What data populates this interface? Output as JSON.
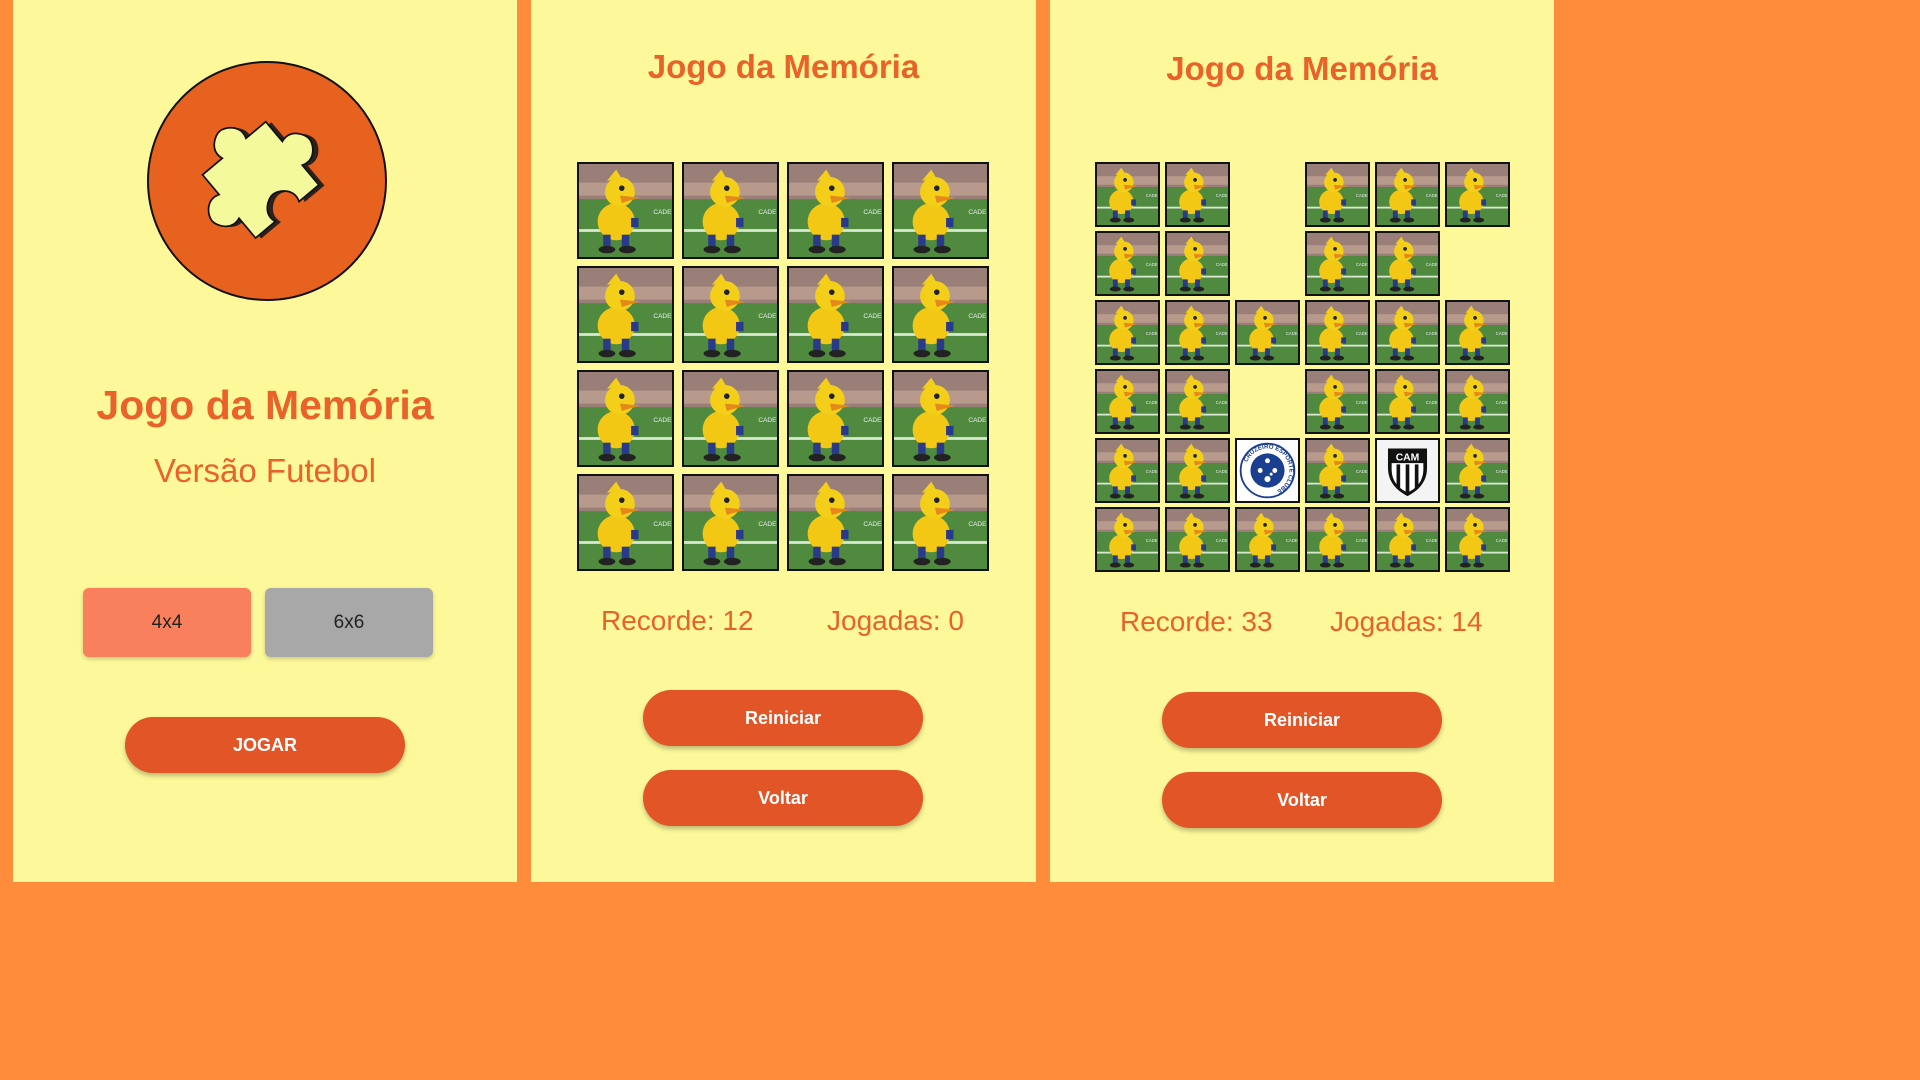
{
  "colors": {
    "accent": "#E8622A",
    "button": "#E15527",
    "background": "#FDF99A",
    "frame": "#FF8C3A",
    "size_4x4": "#F9805D",
    "size_6x6": "#A8A8A8"
  },
  "menu_screen": {
    "logo_icon": "puzzle-piece-icon",
    "title": "Jogo da Memória",
    "subtitle": "Versão Futebol",
    "size_buttons": [
      "4x4",
      "6x6"
    ],
    "play_button": "JOGAR"
  },
  "game_4x4": {
    "title": "Jogo da Memória",
    "grid": {
      "rows": 4,
      "cols": 4
    },
    "cards": [
      "back",
      "back",
      "back",
      "back",
      "back",
      "back",
      "back",
      "back",
      "back",
      "back",
      "back",
      "back",
      "back",
      "back",
      "back",
      "back"
    ],
    "record": "Recorde: 12",
    "moves": "Jogadas: 0",
    "restart_button": "Reiniciar",
    "back_button": "Voltar"
  },
  "game_6x6": {
    "title": "Jogo da Memória",
    "grid": {
      "rows": 6,
      "cols": 6
    },
    "cards": [
      "back",
      "back",
      "empty",
      "back",
      "back",
      "back",
      "back",
      "back",
      "empty",
      "back",
      "back",
      "empty",
      "back",
      "back",
      "back",
      "back",
      "back",
      "back",
      "back",
      "back",
      "empty",
      "back",
      "back",
      "back",
      "back",
      "back",
      "cruzeiro",
      "back",
      "atletico",
      "back",
      "back",
      "back",
      "back",
      "back",
      "back",
      "back"
    ],
    "record": "Recorde: 33",
    "moves": "Jogadas: 14",
    "restart_button": "Reiniciar",
    "back_button": "Voltar",
    "crests": {
      "cruzeiro": {
        "ring_text": "CRUZEIRO ESPORTE CLUBE"
      },
      "atletico": {
        "letters": "CAM"
      }
    }
  }
}
